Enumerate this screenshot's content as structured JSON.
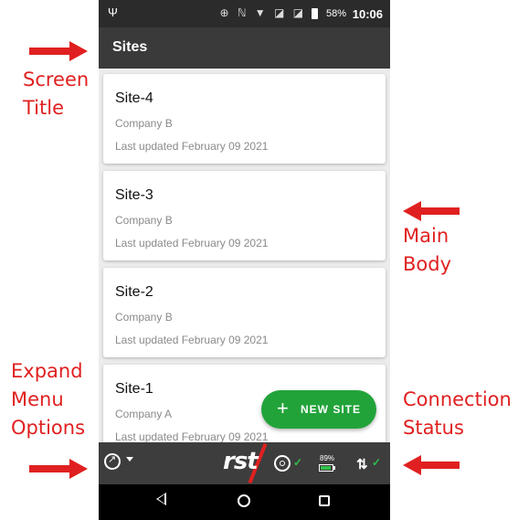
{
  "status_bar": {
    "left_icon": "usb-icon",
    "icons": "⊕ ℕ ▼ ◪ ◪",
    "battery_percent": "58%",
    "time": "10:06"
  },
  "app_bar": {
    "title": "Sites"
  },
  "sites": [
    {
      "name": "Site-4",
      "company": "Company B",
      "updated": "Last updated February 09 2021"
    },
    {
      "name": "Site-3",
      "company": "Company B",
      "updated": "Last updated February 09 2021"
    },
    {
      "name": "Site-2",
      "company": "Company B",
      "updated": "Last updated February 09 2021"
    },
    {
      "name": "Site-1",
      "company": "Company A",
      "updated": "Last updated February 09 2021"
    }
  ],
  "fab": {
    "icon": "plus-icon",
    "label": "NEW SITE",
    "color": "#22a33a"
  },
  "bottom_bar": {
    "menu_icon": "expand-menu-icon",
    "logo": "rst",
    "reader_icon": "reader-icon",
    "reader_connected": true,
    "battery_label": "89%",
    "battery_level": 0.89,
    "connection_icon": "connection-icon",
    "connection_ok": true
  },
  "nav_bar": {
    "back": "back-icon",
    "home": "home-icon",
    "recent": "recent-apps-icon"
  },
  "annotations": {
    "screen_title": "Screen\nTitle",
    "main_body": "Main\nBody",
    "expand_menu": "Expand\nMenu\nOptions",
    "connection_status": "Connection\nStatus",
    "color": "#e02020"
  }
}
